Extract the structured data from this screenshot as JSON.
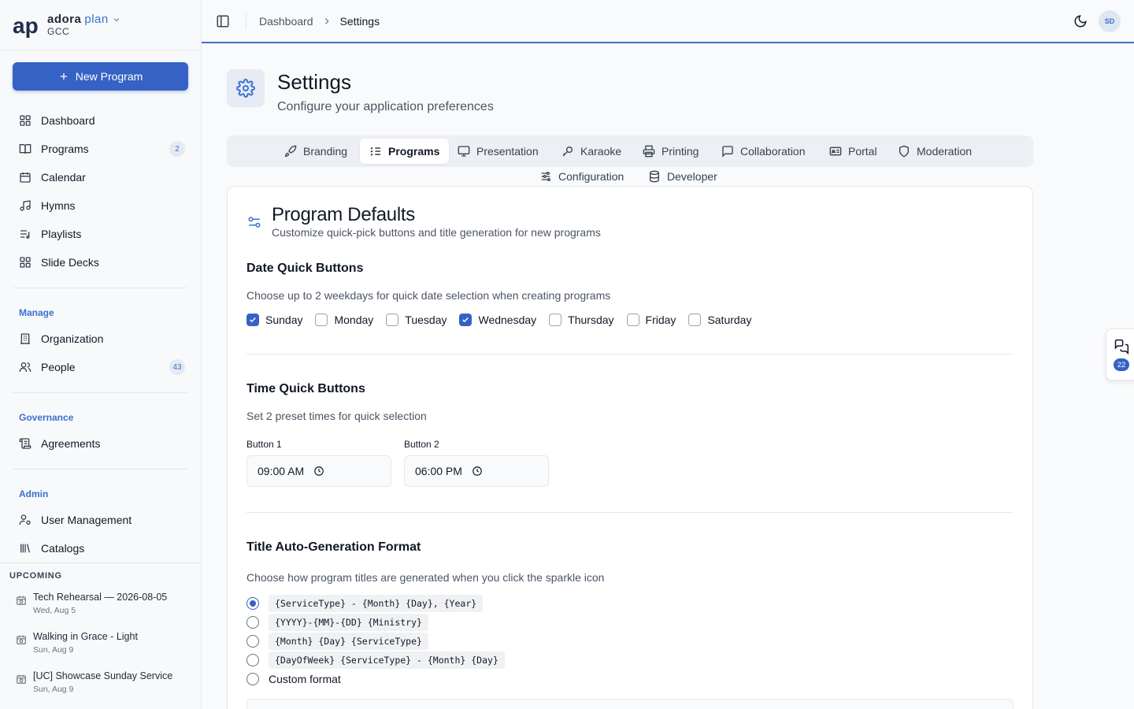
{
  "brand": {
    "name": "adora",
    "name_accent": "plan",
    "org": "GCC"
  },
  "sidebar": {
    "new_program_label": "New Program",
    "main_items": [
      {
        "label": "Dashboard",
        "icon": "grid-icon"
      },
      {
        "label": "Programs",
        "icon": "book-open-icon",
        "badge": "2"
      },
      {
        "label": "Calendar",
        "icon": "calendar-icon"
      },
      {
        "label": "Hymns",
        "icon": "music-note-icon"
      },
      {
        "label": "Playlists",
        "icon": "playlist-icon"
      },
      {
        "label": "Slide Decks",
        "icon": "grid-icon"
      }
    ],
    "manage_label": "Manage",
    "manage_items": [
      {
        "label": "Organization",
        "icon": "building-icon"
      },
      {
        "label": "People",
        "icon": "users-icon",
        "badge": "43"
      }
    ],
    "governance_label": "Governance",
    "governance_items": [
      {
        "label": "Agreements",
        "icon": "scroll-icon"
      }
    ],
    "admin_label": "Admin",
    "admin_items": [
      {
        "label": "User Management",
        "icon": "user-cog-icon"
      },
      {
        "label": "Catalogs",
        "icon": "library-icon"
      }
    ],
    "upcoming": {
      "title": "UPCOMING",
      "items": [
        {
          "title": "Tech Rehearsal — 2026-08-05",
          "date": "Wed, Aug 5"
        },
        {
          "title": "Walking in Grace - Light",
          "date": "Sun, Aug 9"
        },
        {
          "title": "[UC] Showcase Sunday Service",
          "date": "Sun, Aug 9"
        }
      ]
    }
  },
  "topbar": {
    "breadcrumb_root": "Dashboard",
    "breadcrumb_current": "Settings",
    "avatar_initials": "SD"
  },
  "page": {
    "title": "Settings",
    "subtitle": "Configure your application preferences"
  },
  "tabs": [
    {
      "label": "Branding",
      "icon": "rocket-icon"
    },
    {
      "label": "Programs",
      "icon": "list-check-icon",
      "active": true
    },
    {
      "label": "Presentation",
      "icon": "monitor-icon"
    },
    {
      "label": "Karaoke",
      "icon": "microphone-icon"
    },
    {
      "label": "Printing",
      "icon": "printer-icon"
    },
    {
      "label": "Collaboration",
      "icon": "message-square-icon"
    },
    {
      "label": "Portal",
      "icon": "id-card-icon"
    },
    {
      "label": "Moderation",
      "icon": "shield-icon"
    },
    {
      "label": "Configuration",
      "icon": "sliders-icon"
    },
    {
      "label": "Developer",
      "icon": "database-icon"
    }
  ],
  "card": {
    "title": "Program Defaults",
    "subtitle": "Customize quick-pick buttons and title generation for new programs",
    "date_section": {
      "title": "Date Quick Buttons",
      "desc": "Choose up to 2 weekdays for quick date selection when creating programs",
      "days": [
        {
          "label": "Sunday",
          "checked": true
        },
        {
          "label": "Monday",
          "checked": false
        },
        {
          "label": "Tuesday",
          "checked": false
        },
        {
          "label": "Wednesday",
          "checked": true
        },
        {
          "label": "Thursday",
          "checked": false
        },
        {
          "label": "Friday",
          "checked": false
        },
        {
          "label": "Saturday",
          "checked": false
        }
      ]
    },
    "time_section": {
      "title": "Time Quick Buttons",
      "desc": "Set 2 preset times for quick selection",
      "button1_label": "Button 1",
      "button1_value": "09:00 AM",
      "button2_label": "Button 2",
      "button2_value": "06:00 PM"
    },
    "title_section": {
      "title": "Title Auto-Generation Format",
      "desc": "Choose how program titles are generated when you click the sparkle icon",
      "options": [
        {
          "label": "{ServiceType} - {Month} {Day}, {Year}",
          "selected": true
        },
        {
          "label": "{YYYY}-{MM}-{DD} {Ministry}",
          "selected": false
        },
        {
          "label": "{Month} {Day} {ServiceType}",
          "selected": false
        },
        {
          "label": "{DayOfWeek} {ServiceType} - {Month} {Day}",
          "selected": false
        }
      ],
      "custom_label": "Custom format"
    }
  },
  "floating_chat": {
    "badge": "22"
  },
  "colors": {
    "accent": "#3562c4",
    "accent_text": "#3b6fd0"
  }
}
